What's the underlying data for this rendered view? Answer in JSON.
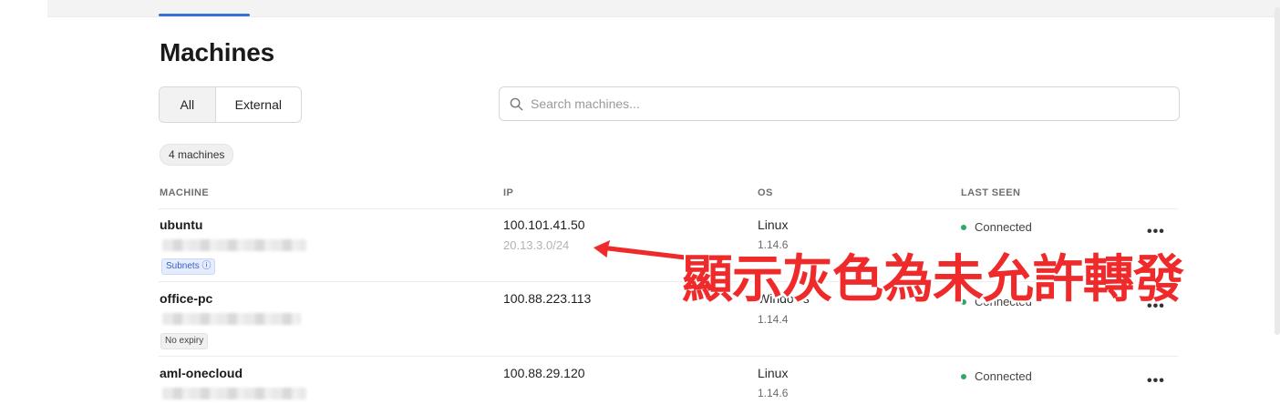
{
  "page": {
    "title": "Machines",
    "filters": {
      "all": "All",
      "external": "External"
    },
    "search": {
      "placeholder": "Search machines..."
    },
    "count": "4 machines",
    "columns": {
      "machine": "MACHINE",
      "ip": "IP",
      "os": "OS",
      "last_seen": "LAST SEEN"
    }
  },
  "machines": [
    {
      "name": "ubuntu",
      "tag": "Subnets ⓘ",
      "ip": "100.101.41.50",
      "subnet": "20.13.3.0/24",
      "os": "Linux",
      "os_version": "1.14.6",
      "status": "Connected",
      "more": "•••"
    },
    {
      "name": "office-pc",
      "tag": "No expiry",
      "ip": "100.88.223.113",
      "os": "Windows",
      "os_version": "1.14.4",
      "status": "Connected",
      "more": "•••"
    },
    {
      "name": "aml-onecloud",
      "ip": "100.88.29.120",
      "os": "Linux",
      "os_version": "1.14.6",
      "status": "Connected",
      "more": "•••"
    }
  ],
  "annotation": {
    "text": "顯示灰色為未允許轉發",
    "color": "#ef2a2a"
  },
  "colors": {
    "accent": "#3b6fd8",
    "connected": "#2fa866"
  }
}
